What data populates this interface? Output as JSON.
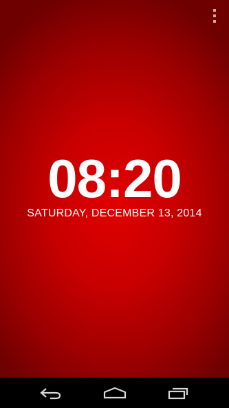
{
  "clock": {
    "time": "08:20",
    "date": "SATURDAY, DECEMBER 13, 2014"
  },
  "action_bar": {
    "overflow_icon": "more-vert-icon"
  },
  "nav_bar": {
    "back_icon": "back-icon",
    "home_icon": "home-icon",
    "recents_icon": "recents-icon"
  },
  "colors": {
    "background_center": "#e00000",
    "background_edge": "#6e0000",
    "text": "#ffffff",
    "nav_bar": "#000000"
  }
}
